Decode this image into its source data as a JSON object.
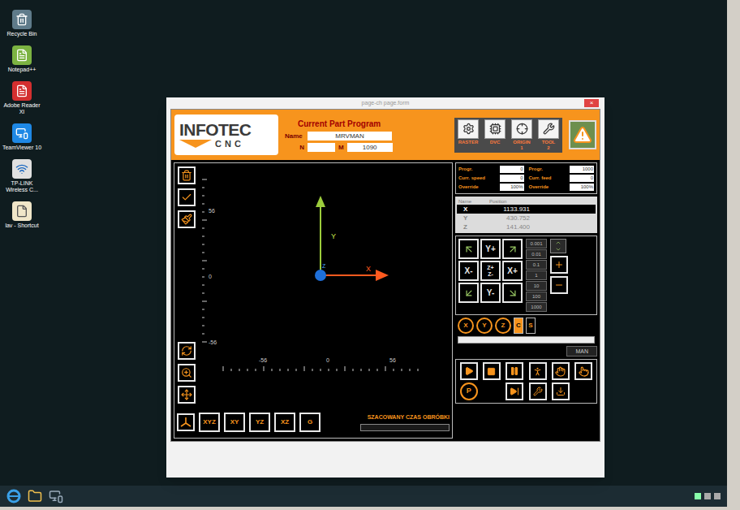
{
  "desktop_icons": [
    {
      "label": "Recycle Bin"
    },
    {
      "label": "Notepad++"
    },
    {
      "label": "Adobe Reader XI"
    },
    {
      "label": "TeamViewer 10"
    },
    {
      "label": "TP-LINK Wireless C..."
    },
    {
      "label": "lav - Shortcut"
    }
  ],
  "window": {
    "title": "page-ch page.form",
    "close": "×"
  },
  "logo": {
    "main": "INFOTEC",
    "sub": "CNC"
  },
  "program": {
    "title": "Current Part Program",
    "name_label": "Name",
    "name_value": "MRVMAN",
    "n_label": "N",
    "n_value": "",
    "m_label": "M",
    "m_value": "1090"
  },
  "toolbar": [
    {
      "label": "RASTER",
      "value": ""
    },
    {
      "label": "DVC",
      "value": ""
    },
    {
      "label": "ORIGIN",
      "value": "1"
    },
    {
      "label": "TOOL",
      "value": "2"
    }
  ],
  "canvas": {
    "axis_labels": {
      "x": "X",
      "y": "Y",
      "z": "Z"
    },
    "vertical_ticks": [
      "56",
      "0",
      "-56"
    ],
    "horizontal_ticks": [
      "-56",
      "0",
      "56"
    ]
  },
  "view_buttons": [
    {
      "label": "XYZ",
      "selected": false
    },
    {
      "label": "XY",
      "selected": false
    },
    {
      "label": "YZ",
      "selected": false
    },
    {
      "label": "XZ",
      "selected": false
    },
    {
      "label": "G",
      "selected": false
    }
  ],
  "estimate": {
    "label": "SZACOWANY CZAS OBRÓBKI",
    "level": 0
  },
  "speeds": {
    "left": [
      {
        "label": "Progr.",
        "value": "0"
      },
      {
        "label": "Curr. speed",
        "value": "0"
      },
      {
        "label": "Override",
        "value": "100%"
      }
    ],
    "right": [
      {
        "label": "Progr.",
        "value": "1000"
      },
      {
        "label": "Curr. feed",
        "value": "0"
      },
      {
        "label": "Override",
        "value": "100%"
      }
    ]
  },
  "positions": {
    "header": {
      "name": "Name",
      "position": "Position"
    },
    "rows": [
      {
        "name": "X",
        "value": "1133.931",
        "selected": true
      },
      {
        "name": "Y",
        "value": "430.752",
        "selected": false
      },
      {
        "name": "Z",
        "value": "141.400",
        "selected": false
      }
    ]
  },
  "jog": [
    {
      "kind": "arrow",
      "labels": []
    },
    {
      "kind": "text",
      "labels": [
        "Y+"
      ]
    },
    {
      "kind": "arrow",
      "labels": []
    },
    {
      "kind": "text",
      "labels": [
        "X-"
      ]
    },
    {
      "kind": "z",
      "labels": [
        "Z+",
        "Z-"
      ]
    },
    {
      "kind": "text",
      "labels": [
        "X+"
      ]
    },
    {
      "kind": "arrow",
      "labels": []
    },
    {
      "kind": "text",
      "labels": [
        "Y-"
      ]
    },
    {
      "kind": "arrow",
      "labels": []
    }
  ],
  "steps": [
    {
      "label": "0.001",
      "selected": false
    },
    {
      "label": "0.01",
      "selected": false
    },
    {
      "label": "0.1",
      "selected": false
    },
    {
      "label": "1",
      "selected": false
    },
    {
      "label": "10",
      "selected": false
    },
    {
      "label": "100",
      "selected": false
    },
    {
      "label": "1000",
      "selected": false
    }
  ],
  "axis_select": [
    {
      "label": "X",
      "kind": "circle",
      "selected": false
    },
    {
      "label": "Y",
      "kind": "circle",
      "selected": false
    },
    {
      "label": "Z",
      "kind": "circle",
      "selected": false
    },
    {
      "label": "C",
      "kind": "box",
      "selected": true
    },
    {
      "label": "S",
      "kind": "box",
      "selected": false
    }
  ],
  "feed_slider": {
    "level": 0
  },
  "mode": "MAN",
  "controls": {
    "p_label": "P"
  }
}
